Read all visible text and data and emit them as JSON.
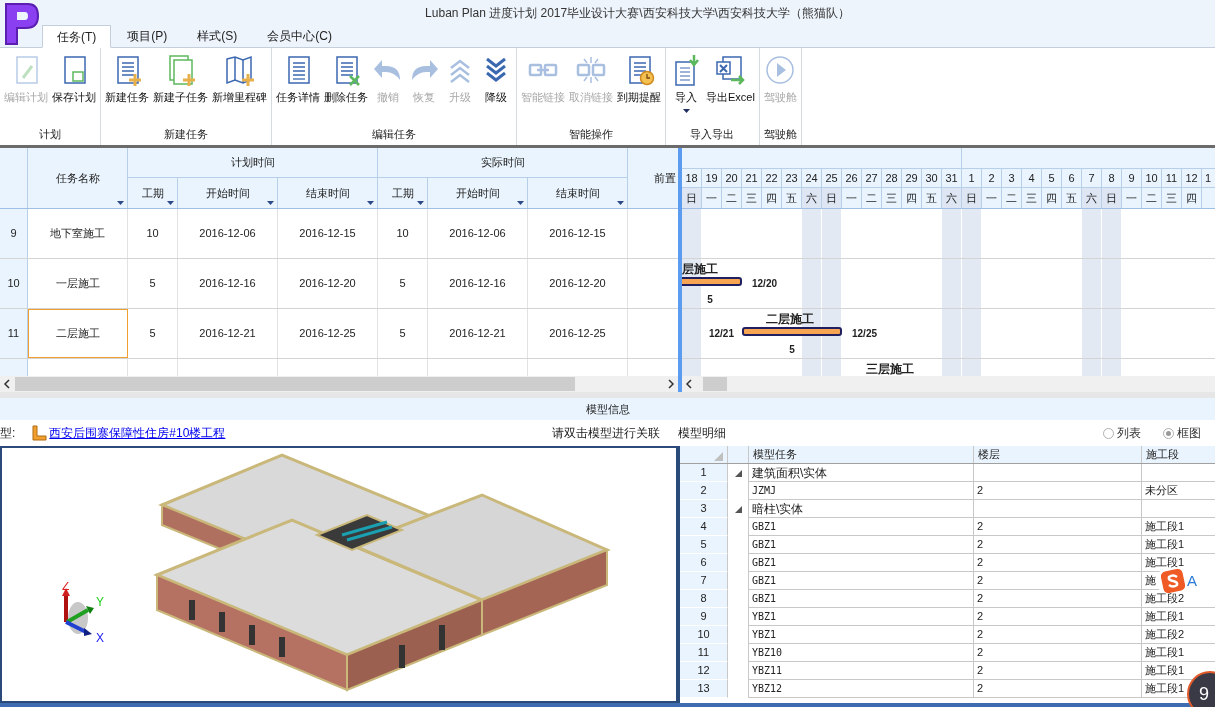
{
  "window": {
    "title": "Luban Plan 进度计划 2017毕业设计大赛\\西安科技大学\\西安科技大学（熊猫队）"
  },
  "tabs": [
    {
      "label": "任务(T)",
      "selected": true
    },
    {
      "label": "项目(P)",
      "selected": false
    },
    {
      "label": "样式(S)",
      "selected": false
    },
    {
      "label": "会员中心(C)",
      "selected": false
    }
  ],
  "ribbon": {
    "groups": [
      {
        "label": "计划",
        "buttons": [
          {
            "label": "编辑计划",
            "kind": "edit",
            "disabled": true
          },
          {
            "label": "保存计划",
            "kind": "save",
            "disabled": false
          }
        ]
      },
      {
        "label": "新建任务",
        "buttons": [
          {
            "label": "新建任务",
            "kind": "list-add",
            "disabled": false
          },
          {
            "label": "新建子任务",
            "kind": "sub-add",
            "disabled": false
          },
          {
            "label": "新增里程碑",
            "kind": "map-add",
            "disabled": false
          }
        ]
      },
      {
        "label": "编辑任务",
        "buttons": [
          {
            "label": "任务详情",
            "kind": "list",
            "disabled": false
          },
          {
            "label": "删除任务",
            "kind": "list-delete",
            "disabled": false
          },
          {
            "label": "撤销",
            "kind": "undo",
            "disabled": true
          },
          {
            "label": "恢复",
            "kind": "redo",
            "disabled": true
          },
          {
            "label": "升级",
            "kind": "up",
            "disabled": true
          },
          {
            "label": "降级",
            "kind": "down",
            "disabled": false
          }
        ]
      },
      {
        "label": "智能操作",
        "buttons": [
          {
            "label": "智能链接",
            "kind": "link",
            "disabled": true
          },
          {
            "label": "取消链接",
            "kind": "unlink",
            "disabled": true
          },
          {
            "label": "到期提醒",
            "kind": "alarm",
            "disabled": false
          }
        ]
      },
      {
        "label": "导入导出",
        "buttons": [
          {
            "label": "导入",
            "kind": "import",
            "disabled": false,
            "dropdown": true
          },
          {
            "label": "导出Excel",
            "kind": "excel",
            "disabled": false
          }
        ]
      },
      {
        "label": "驾驶舱",
        "buttons": [
          {
            "label": "驾驶舱",
            "kind": "play",
            "disabled": true
          }
        ]
      }
    ]
  },
  "task_table": {
    "name_header": "任务名称",
    "groups": [
      {
        "label": "计划时间",
        "columns": [
          "工期",
          "开始时间",
          "结束时间"
        ]
      },
      {
        "label": "实际时间",
        "columns": [
          "工期",
          "开始时间",
          "结束时间"
        ]
      }
    ],
    "predecessor_header": "前置",
    "rows": [
      {
        "id": "9",
        "name": "地下室施工",
        "cells": [
          "10",
          "2016-12-06",
          "2016-12-15",
          "10",
          "2016-12-06",
          "2016-12-15"
        ],
        "selected": false
      },
      {
        "id": "10",
        "name": "一层施工",
        "cells": [
          "5",
          "2016-12-16",
          "2016-12-20",
          "5",
          "2016-12-16",
          "2016-12-20"
        ],
        "selected": false,
        "bar": {
          "label": "层施工",
          "end_label": "12/20",
          "duration_label": "5"
        }
      },
      {
        "id": "11",
        "name": "二层施工",
        "cells": [
          "5",
          "2016-12-21",
          "2016-12-25",
          "5",
          "2016-12-21",
          "2016-12-25"
        ],
        "selected": true,
        "bar": {
          "label": "二层施工",
          "start_label": "12/21",
          "end_label": "12/25",
          "duration_label": "5"
        }
      },
      {
        "selected": false,
        "bar": {
          "label": "三层施工"
        }
      }
    ]
  },
  "timeline": {
    "days": [
      {
        "date": "18",
        "weekday": "日",
        "weekend": true
      },
      {
        "date": "19",
        "weekday": "一",
        "weekend": false
      },
      {
        "date": "20",
        "weekday": "二",
        "weekend": false
      },
      {
        "date": "21",
        "weekday": "三",
        "weekend": false
      },
      {
        "date": "22",
        "weekday": "四",
        "weekend": false
      },
      {
        "date": "23",
        "weekday": "五",
        "weekend": false
      },
      {
        "date": "24",
        "weekday": "六",
        "weekend": true
      },
      {
        "date": "25",
        "weekday": "日",
        "weekend": true
      },
      {
        "date": "26",
        "weekday": "一",
        "weekend": false
      },
      {
        "date": "27",
        "weekday": "二",
        "weekend": false
      },
      {
        "date": "28",
        "weekday": "三",
        "weekend": false
      },
      {
        "date": "29",
        "weekday": "四",
        "weekend": false
      },
      {
        "date": "30",
        "weekday": "五",
        "weekend": false
      },
      {
        "date": "31",
        "weekday": "六",
        "weekend": true
      },
      {
        "date": "1",
        "weekday": "日",
        "weekend": true
      },
      {
        "date": "2",
        "weekday": "一",
        "weekend": false
      },
      {
        "date": "3",
        "weekday": "二",
        "weekend": false
      },
      {
        "date": "4",
        "weekday": "三",
        "weekend": false
      },
      {
        "date": "5",
        "weekday": "四",
        "weekend": false
      },
      {
        "date": "6",
        "weekday": "五",
        "weekend": false
      },
      {
        "date": "7",
        "weekday": "六",
        "weekend": true
      },
      {
        "date": "8",
        "weekday": "日",
        "weekend": true
      },
      {
        "date": "9",
        "weekday": "一",
        "weekend": false
      },
      {
        "date": "10",
        "weekday": "二",
        "weekend": false
      },
      {
        "date": "11",
        "weekday": "三",
        "weekend": false
      },
      {
        "date": "12",
        "weekday": "四",
        "weekend": false
      },
      {
        "date": "1",
        "weekend": false
      }
    ]
  },
  "model_info": {
    "title": "模型信息",
    "model_label": "型:",
    "model_link": "西安后围寨保障性住房#10楼工程",
    "hint": "请双击模型进行关联",
    "axes": [
      "Z",
      "Y",
      "X"
    ]
  },
  "model_detail": {
    "title": "模型明细",
    "view_options": [
      {
        "label": "列表",
        "selected": false
      },
      {
        "label": "框图",
        "selected": true
      }
    ],
    "columns": [
      "模型任务",
      "楼层",
      "施工段"
    ],
    "rows": [
      {
        "num": "1",
        "kind": "group",
        "expanded": true,
        "task": "建筑面积\\实体"
      },
      {
        "num": "2",
        "kind": "item",
        "task": "JZMJ",
        "floor": "2",
        "segment": "未分区"
      },
      {
        "num": "3",
        "kind": "group",
        "expanded": true,
        "task": "暗柱\\实体"
      },
      {
        "num": "4",
        "kind": "item",
        "task": "GBZ1",
        "floor": "2",
        "segment": "施工段1"
      },
      {
        "num": "5",
        "kind": "item",
        "task": "GBZ1",
        "floor": "2",
        "segment": "施工段1"
      },
      {
        "num": "6",
        "kind": "item",
        "task": "GBZ1",
        "floor": "2",
        "segment": "施工段1"
      },
      {
        "num": "7",
        "kind": "item",
        "task": "GBZ1",
        "floor": "2",
        "segment": "施"
      },
      {
        "num": "8",
        "kind": "item",
        "task": "GBZ1",
        "floor": "2",
        "segment": "施工段2"
      },
      {
        "num": "9",
        "kind": "item",
        "task": "YBZ1",
        "floor": "2",
        "segment": "施工段1"
      },
      {
        "num": "10",
        "kind": "item",
        "task": "YBZ1",
        "floor": "2",
        "segment": "施工段2"
      },
      {
        "num": "11",
        "kind": "item",
        "task": "YBZ10",
        "floor": "2",
        "segment": "施工段1"
      },
      {
        "num": "12",
        "kind": "item",
        "task": "YBZ11",
        "floor": "2",
        "segment": "施工段1"
      },
      {
        "num": "13",
        "kind": "item",
        "task": "YBZ12",
        "floor": "2",
        "segment": "施工段1"
      }
    ]
  },
  "overlays": {
    "ime_letter": "A",
    "gauge_text": "9"
  }
}
